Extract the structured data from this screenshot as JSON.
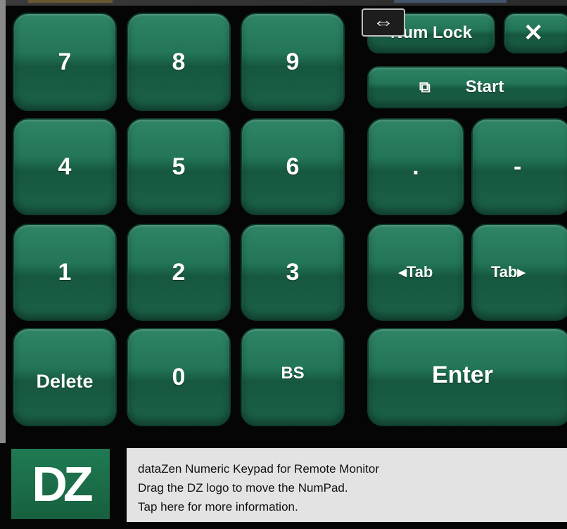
{
  "keypad": {
    "digits": {
      "k7": "7",
      "k8": "8",
      "k9": "9",
      "k4": "4",
      "k5": "5",
      "k6": "6",
      "k1": "1",
      "k2": "2",
      "k3": "3",
      "k0": "0"
    },
    "delete_label": "Delete",
    "backspace_label": "BS",
    "num_lock_label": "Num Lock",
    "close_label": "✕",
    "start_icon": "⧉",
    "start_label": "Start",
    "decimal_label": ".",
    "minus_label": "-",
    "tab_back_label": "◂Tab",
    "tab_forward_label": "Tab▸",
    "enter_label": "Enter",
    "resize_icon": "⇔"
  },
  "footer": {
    "logo_text": "DZ",
    "info_lines": [
      "dataZen Numeric Keypad for Remote Monitor",
      "Drag the DZ logo to move the NumPad.",
      "Tap here for more information."
    ]
  },
  "colors": {
    "key_green": "#237657",
    "background": "#050505",
    "info_panel": "#e3e3e3"
  }
}
